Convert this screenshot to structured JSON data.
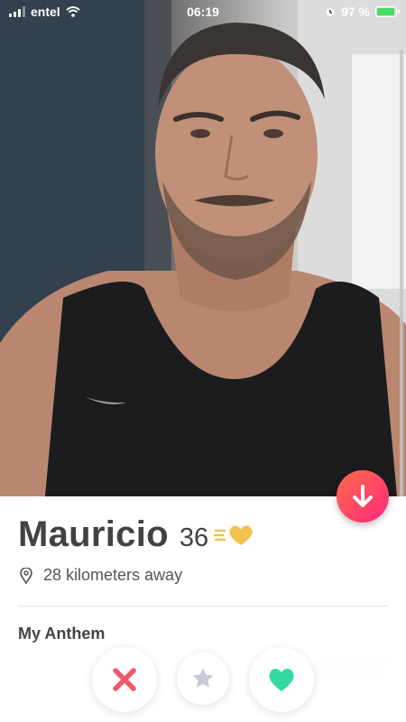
{
  "status_bar": {
    "carrier": "entel",
    "time": "06:19",
    "battery_percent_label": "97 %",
    "battery_level": 0.97
  },
  "profile": {
    "name": "Mauricio",
    "age": "36",
    "distance": "28 kilometers away",
    "anthem_section_title": "My Anthem"
  },
  "icons": {
    "status": [
      "signal-icon",
      "wifi-icon",
      "alarm-icon",
      "charging-bolt-icon"
    ],
    "profile": [
      "superlike-heart-icon",
      "location-pin-icon",
      "arrow-down-icon"
    ],
    "actions": [
      "nope-x-icon",
      "super-like-star-icon",
      "like-heart-icon"
    ]
  },
  "colors": {
    "brand_gradient_start": "#ff6b4a",
    "brand_gradient_end": "#fd297b",
    "nope_red": "#f0576a",
    "star_gray": "#c5ccd6",
    "like_green": "#33d9a0",
    "superlike_gold": "#f2c14e",
    "battery_green": "#4cd964"
  }
}
